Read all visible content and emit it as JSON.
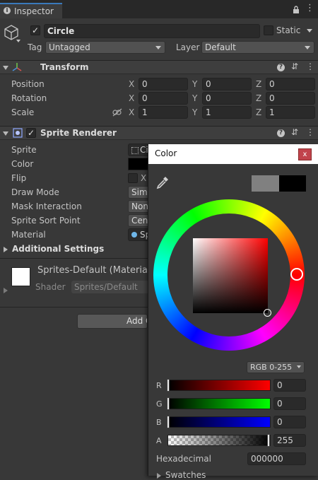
{
  "tab": {
    "title": "Inspector"
  },
  "object": {
    "name": "Circle",
    "static_label": "Static",
    "tag_label": "Tag",
    "tag_value": "Untagged",
    "layer_label": "Layer",
    "layer_value": "Default"
  },
  "transform": {
    "title": "Transform",
    "rows": [
      {
        "label": "Position",
        "x": "0",
        "y": "0",
        "z": "0"
      },
      {
        "label": "Rotation",
        "x": "0",
        "y": "0",
        "z": "0"
      },
      {
        "label": "Scale",
        "x": "1",
        "y": "1",
        "z": "1"
      }
    ],
    "axis": {
      "x": "X",
      "y": "Y",
      "z": "Z"
    }
  },
  "sprite_renderer": {
    "title": "Sprite Renderer",
    "sprite_label": "Sprite",
    "sprite_value": "Ci",
    "color_label": "Color",
    "flip_label": "Flip",
    "flip_x": "X",
    "draw_mode_label": "Draw Mode",
    "draw_mode_value": "Simp",
    "mask_label": "Mask Interaction",
    "mask_value": "None",
    "sort_label": "Sprite Sort Point",
    "sort_value": "Cen",
    "material_label": "Material",
    "material_value": "Sp",
    "additional_label": "Additional Settings"
  },
  "material": {
    "name": "Sprites-Default (Material)",
    "shader_label": "Shader",
    "shader_value": "Sprites/Default"
  },
  "add_component": {
    "label": "Add C"
  },
  "color_picker": {
    "title": "Color",
    "close": "x",
    "mode": "RGB 0-255",
    "r_label": "R",
    "r_value": "0",
    "g_label": "G",
    "g_value": "0",
    "b_label": "B",
    "b_value": "0",
    "a_label": "A",
    "a_value": "255",
    "hex_label": "Hexadecimal",
    "hex_value": "000000",
    "swatches_label": "Swatches",
    "colors": {
      "previous": "#808080",
      "current": "#000000"
    }
  }
}
